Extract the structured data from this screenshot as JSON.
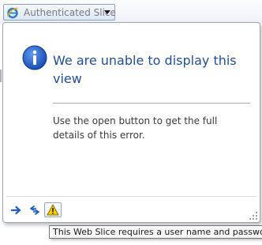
{
  "slice_button": {
    "title": "Authenticated Slice",
    "icon": "ie-icon",
    "dropdown_icon": "chevron-down-icon"
  },
  "popup": {
    "status_icon": "info-icon",
    "title": "We are unable to display this view",
    "detail": "Use the open button to get the full details of this error."
  },
  "footer": {
    "buttons": [
      {
        "name": "open-button",
        "icon": "arrow-right-icon"
      },
      {
        "name": "refresh-button",
        "icon": "refresh-icon"
      },
      {
        "name": "warning-button",
        "icon": "warning-icon"
      }
    ]
  },
  "tooltip": {
    "text": "This Web Slice requires a user name and password"
  },
  "colors": {
    "title_blue": "#1e4f9c",
    "info_blue": "#1b5fc6",
    "warning_yellow": "#f5d000"
  }
}
